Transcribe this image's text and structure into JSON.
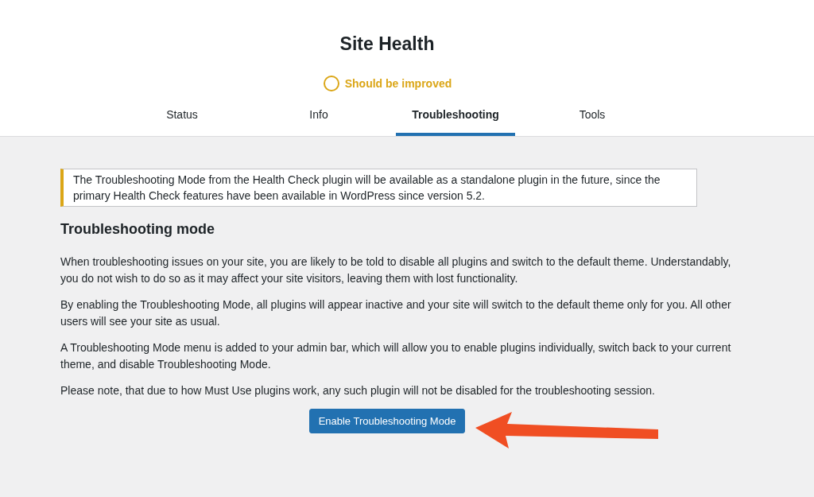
{
  "title": "Site Health",
  "status": {
    "label": "Should be improved"
  },
  "tabs": [
    {
      "label": "Status",
      "selected": false
    },
    {
      "label": "Info",
      "selected": false
    },
    {
      "label": "Troubleshooting",
      "selected": true
    },
    {
      "label": "Tools",
      "selected": false
    }
  ],
  "notice": "The Troubleshooting Mode from the Health Check plugin will be available as a standalone plugin in the future, since the primary Health Check features have been available in WordPress since version 5.2.",
  "section": {
    "heading": "Troubleshooting mode",
    "paragraphs": [
      "When troubleshooting issues on your site, you are likely to be told to disable all plugins and switch to the default theme. Understandably, you do not wish to do so as it may affect your site visitors, leaving them with lost functionality.",
      "By enabling the Troubleshooting Mode, all plugins will appear inactive and your site will switch to the default theme only for you. All other users will see your site as usual.",
      "A Troubleshooting Mode menu is added to your admin bar, which will allow you to enable plugins individually, switch back to your current theme, and disable Troubleshooting Mode.",
      "Please note, that due to how Must Use plugins work, any such plugin will not be disabled for the troubleshooting session."
    ],
    "button": "Enable Troubleshooting Mode"
  }
}
